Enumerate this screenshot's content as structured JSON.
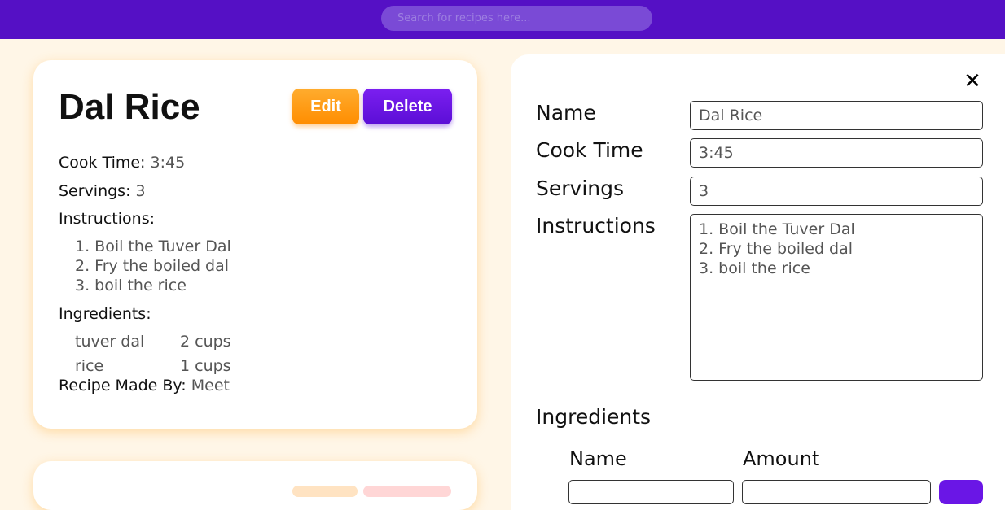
{
  "header": {
    "search_placeholder": "Search for recipes here..."
  },
  "recipe_card": {
    "title": "Dal Rice",
    "edit_label": "Edit",
    "delete_label": "Delete",
    "cook_time_label": "Cook Time:",
    "cook_time": "3:45",
    "servings_label": "Servings:",
    "servings": "3",
    "instructions_label": "Instructions:",
    "instructions": [
      "1. Boil the Tuver Dal",
      "2. Fry the boiled dal",
      "3. boil the rice"
    ],
    "ingredients_label": "Ingredients:",
    "ingredients": [
      {
        "name": "tuver dal",
        "amount": "2 cups"
      },
      {
        "name": "rice",
        "amount": "1 cups"
      }
    ],
    "made_by_label": "Recipe Made By:",
    "made_by": "Meet"
  },
  "edit_panel": {
    "close_icon": "close-icon",
    "name_label": "Name",
    "name_value": "Dal Rice",
    "cook_time_label": "Cook Time",
    "cook_time_value": "3:45",
    "servings_label": "Servings",
    "servings_value": "3",
    "instructions_label": "Instructions",
    "instructions_value": "1. Boil the Tuver Dal\n2. Fry the boiled dal\n3. boil the rice",
    "ingredients_label": "Ingredients",
    "ingredient_name_header": "Name",
    "ingredient_amount_header": "Amount"
  },
  "colors": {
    "header_bg": "#5510c5",
    "page_bg": "#fff6e7",
    "edit_button": "#ff9a1a",
    "delete_button": "#6a16e6"
  }
}
